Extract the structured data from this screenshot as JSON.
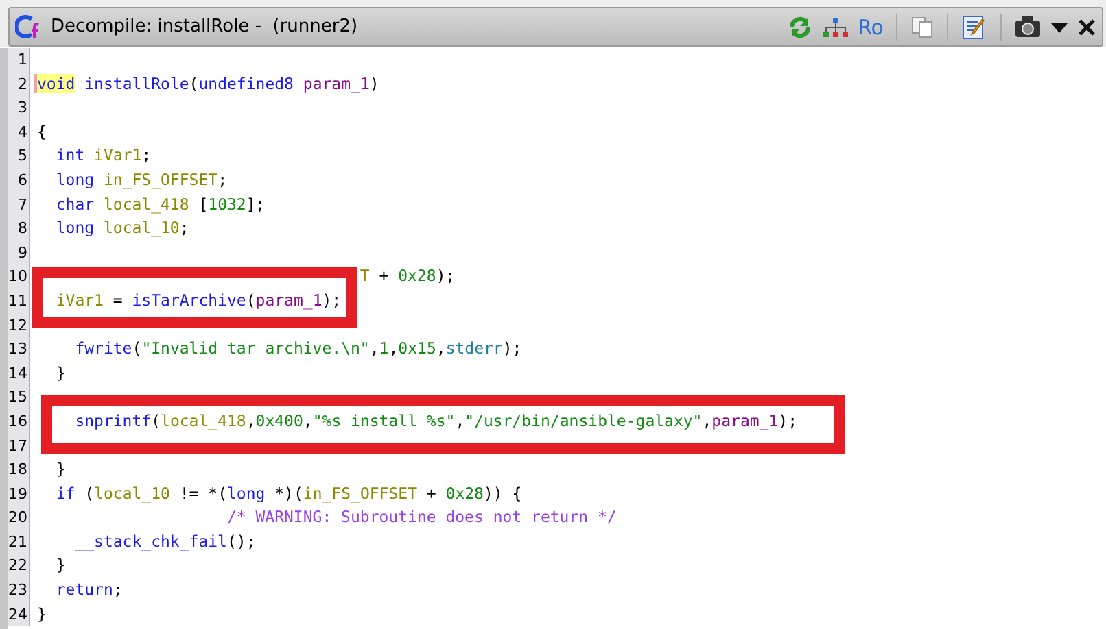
{
  "window": {
    "title": "Decompile: installRole -  (runner2)"
  },
  "toolbar": {
    "read_only_label": "Ro"
  },
  "code": [
    {
      "n": "1"
    },
    {
      "n": "2",
      "tokens": [
        {
          "text": "void",
          "kind": "kw",
          "highlighted": true
        },
        {
          "text": " installRole",
          "kind": "fn"
        },
        {
          "text": "(",
          "kind": "plain"
        },
        {
          "text": "undefined8",
          "kind": "kw"
        },
        {
          "text": " param_1",
          "kind": "param"
        },
        {
          "text": ")",
          "kind": "plain"
        }
      ]
    },
    {
      "n": "3"
    },
    {
      "n": "4",
      "tokens": [
        {
          "text": "{",
          "kind": "plain"
        }
      ]
    },
    {
      "n": "5",
      "tokens": [
        {
          "text": "  int",
          "kind": "kw"
        },
        {
          "text": " iVar1",
          "kind": "var"
        },
        {
          "text": ";",
          "kind": "plain"
        }
      ]
    },
    {
      "n": "6",
      "tokens": [
        {
          "text": "  long",
          "kind": "kw"
        },
        {
          "text": " in_FS_OFFSET",
          "kind": "var"
        },
        {
          "text": ";",
          "kind": "plain"
        }
      ]
    },
    {
      "n": "7",
      "tokens": [
        {
          "text": "  char",
          "kind": "kw"
        },
        {
          "text": " local_418",
          "kind": "var"
        },
        {
          "text": " [",
          "kind": "plain"
        },
        {
          "text": "1032",
          "kind": "num"
        },
        {
          "text": "];",
          "kind": "plain"
        }
      ]
    },
    {
      "n": "8",
      "tokens": [
        {
          "text": "  long",
          "kind": "kw"
        },
        {
          "text": " local_10",
          "kind": "var"
        },
        {
          "text": ";",
          "kind": "plain"
        }
      ]
    },
    {
      "n": "9"
    },
    {
      "n": "10",
      "tokens": [
        {
          "text": "                                  T",
          "kind": "var"
        },
        {
          "text": " + ",
          "kind": "plain"
        },
        {
          "text": "0x28",
          "kind": "num"
        },
        {
          "text": ");",
          "kind": "plain"
        }
      ]
    },
    {
      "n": "11",
      "tokens": [
        {
          "text": "  iVar1",
          "kind": "var"
        },
        {
          "text": " = ",
          "kind": "plain"
        },
        {
          "text": "isTarArchive",
          "kind": "fn"
        },
        {
          "text": "(",
          "kind": "plain"
        },
        {
          "text": "param_1",
          "kind": "param"
        },
        {
          "text": ");",
          "kind": "plain"
        }
      ]
    },
    {
      "n": "12"
    },
    {
      "n": "13",
      "tokens": [
        {
          "text": "    fwrite",
          "kind": "fn"
        },
        {
          "text": "(",
          "kind": "plain"
        },
        {
          "text": "\"Invalid tar archive.\\n\"",
          "kind": "str"
        },
        {
          "text": ",",
          "kind": "plain"
        },
        {
          "text": "1",
          "kind": "num"
        },
        {
          "text": ",",
          "kind": "plain"
        },
        {
          "text": "0x15",
          "kind": "num"
        },
        {
          "text": ",",
          "kind": "plain"
        },
        {
          "text": "stderr",
          "kind": "global"
        },
        {
          "text": ");",
          "kind": "plain"
        }
      ]
    },
    {
      "n": "14",
      "tokens": [
        {
          "text": "  }",
          "kind": "plain"
        }
      ]
    },
    {
      "n": "15"
    },
    {
      "n": "16",
      "tokens": [
        {
          "text": "    snprintf",
          "kind": "fn"
        },
        {
          "text": "(",
          "kind": "plain"
        },
        {
          "text": "local_418",
          "kind": "var"
        },
        {
          "text": ",",
          "kind": "plain"
        },
        {
          "text": "0x400",
          "kind": "num"
        },
        {
          "text": ",",
          "kind": "plain"
        },
        {
          "text": "\"%s install %s\"",
          "kind": "str"
        },
        {
          "text": ",",
          "kind": "plain"
        },
        {
          "text": "\"/usr/bin/ansible-galaxy\"",
          "kind": "str"
        },
        {
          "text": ",",
          "kind": "plain"
        },
        {
          "text": "param_1",
          "kind": "param"
        },
        {
          "text": ");",
          "kind": "plain"
        }
      ]
    },
    {
      "n": "17"
    },
    {
      "n": "18",
      "tokens": [
        {
          "text": "  }",
          "kind": "plain"
        }
      ]
    },
    {
      "n": "19",
      "tokens": [
        {
          "text": "  if",
          "kind": "kw"
        },
        {
          "text": " (",
          "kind": "plain"
        },
        {
          "text": "local_10",
          "kind": "var"
        },
        {
          "text": " != *(",
          "kind": "plain"
        },
        {
          "text": "long",
          "kind": "kw"
        },
        {
          "text": " *)(",
          "kind": "plain"
        },
        {
          "text": "in_FS_OFFSET",
          "kind": "var"
        },
        {
          "text": " + ",
          "kind": "plain"
        },
        {
          "text": "0x28",
          "kind": "num"
        },
        {
          "text": ")) {",
          "kind": "plain"
        }
      ]
    },
    {
      "n": "20",
      "tokens": [
        {
          "text": "                    /* WARNING: Subroutine does not return */",
          "kind": "cmt"
        }
      ]
    },
    {
      "n": "21",
      "tokens": [
        {
          "text": "    __stack_chk_fail",
          "kind": "fn"
        },
        {
          "text": "();",
          "kind": "plain"
        }
      ]
    },
    {
      "n": "22",
      "tokens": [
        {
          "text": "  }",
          "kind": "plain"
        }
      ]
    },
    {
      "n": "23",
      "tokens": [
        {
          "text": "  return",
          "kind": "kw"
        },
        {
          "text": ";",
          "kind": "plain"
        }
      ]
    },
    {
      "n": "24",
      "tokens": [
        {
          "text": "}",
          "kind": "plain"
        }
      ]
    }
  ],
  "annotations": [
    {
      "kind": "box"
    },
    {
      "kind": "box"
    }
  ]
}
